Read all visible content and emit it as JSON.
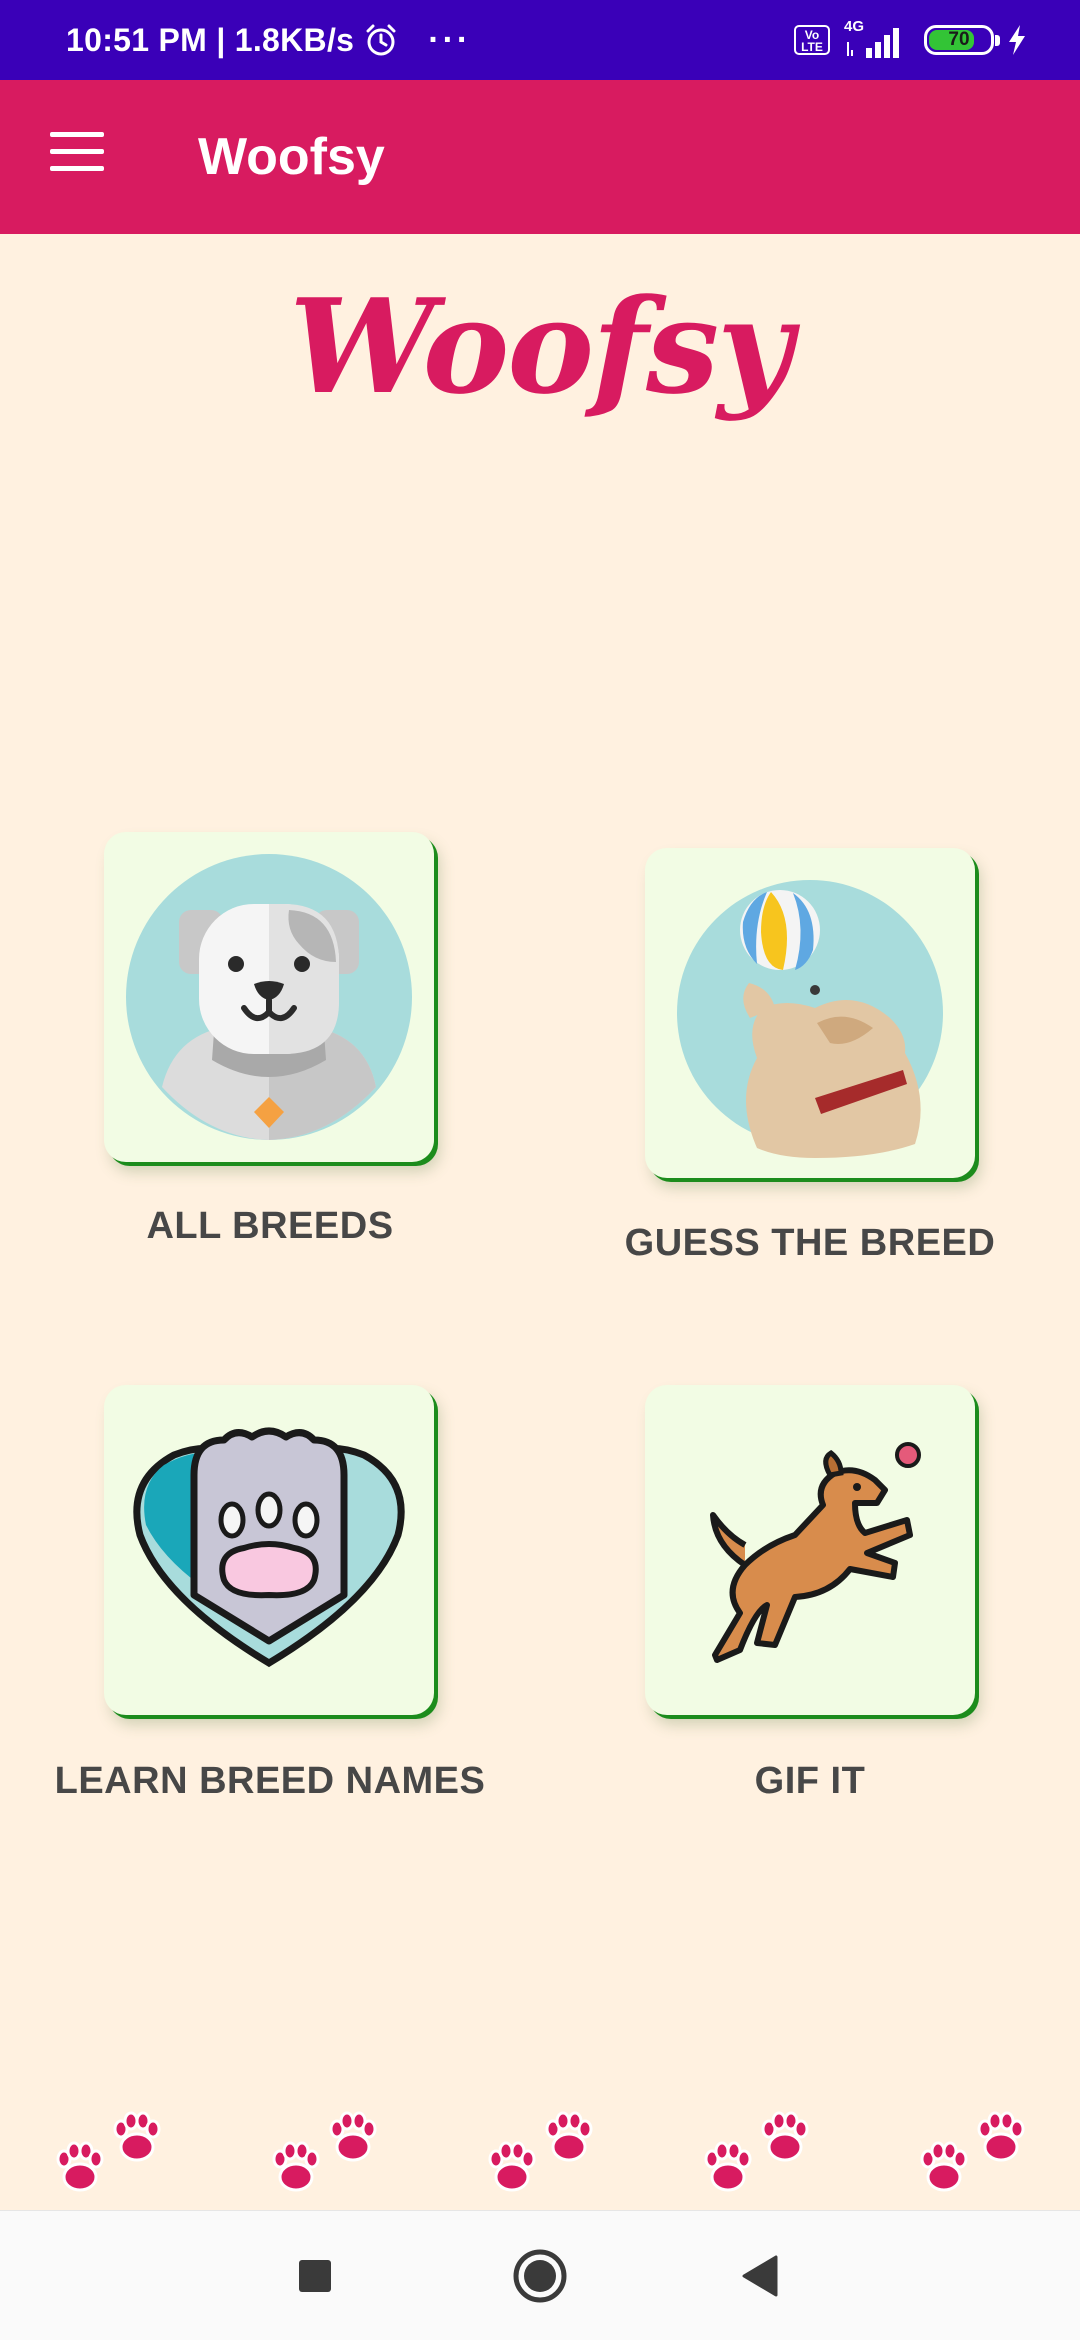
{
  "status_bar": {
    "time_speed": "10:51 PM | 1.8KB/s",
    "more": "···",
    "volte": "Vo LTE",
    "network": "4G",
    "battery": "70"
  },
  "app_bar": {
    "title": "Woofsy"
  },
  "logo": {
    "text": "Woofsy"
  },
  "menu": [
    {
      "label": "ALL BREEDS",
      "icon": "dog-face-icon"
    },
    {
      "label": "GUESS THE BREED",
      "icon": "dog-ball-icon"
    },
    {
      "label": "LEARN BREED NAMES",
      "icon": "paw-heart-icon"
    },
    {
      "label": "GIF IT",
      "icon": "jumping-dog-icon"
    }
  ],
  "colors": {
    "status_bar": "#3a00b8",
    "app_bar": "#d81b60",
    "background": "#fff1e0",
    "card": "#f2fce4",
    "card_border": "#1c8c1c",
    "label": "#474747"
  }
}
